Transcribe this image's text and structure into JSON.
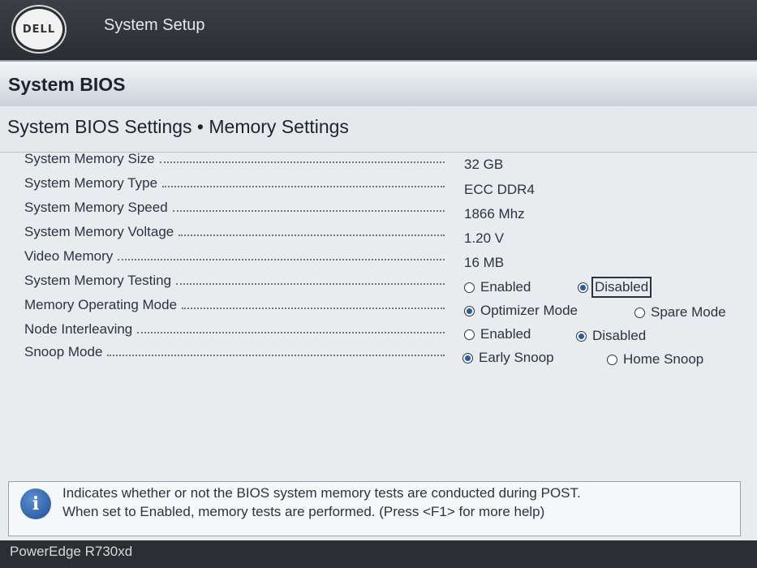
{
  "header": {
    "logo_text": "DELL",
    "app_title": "System Setup"
  },
  "section_title": "System BIOS",
  "page_title": "System BIOS Settings • Memory Settings",
  "rows": [
    {
      "label": "System Memory Size",
      "value": "32 GB"
    },
    {
      "label": "System Memory Type",
      "value": "ECC DDR4"
    },
    {
      "label": "System Memory Speed",
      "value": "1866 Mhz"
    },
    {
      "label": "System Memory Voltage",
      "value": "1.20 V"
    },
    {
      "label": "Video Memory",
      "value": "16 MB"
    },
    {
      "label": "System Memory Testing",
      "options": [
        "Enabled",
        "Disabled"
      ],
      "selected": "Disabled"
    },
    {
      "label": "Memory Operating Mode",
      "options": [
        "Optimizer Mode",
        "Spare Mode"
      ],
      "selected": "Optimizer Mode"
    },
    {
      "label": "Node Interleaving",
      "options": [
        "Enabled",
        "Disabled"
      ],
      "selected": "Disabled"
    },
    {
      "label": "Snoop Mode",
      "options": [
        "Early Snoop",
        "Home Snoop"
      ],
      "selected": "Early Snoop"
    }
  ],
  "help": {
    "icon": "info-icon",
    "line1": "Indicates whether or not the BIOS system memory tests are conducted during POST.",
    "line2": "When set to Enabled, memory tests are performed. (Press <F1> for more help)"
  },
  "footer": {
    "model": "PowerEdge R730xd"
  },
  "colors": {
    "accent": "#1f5fa8",
    "header_bg": "#2a2d31"
  }
}
